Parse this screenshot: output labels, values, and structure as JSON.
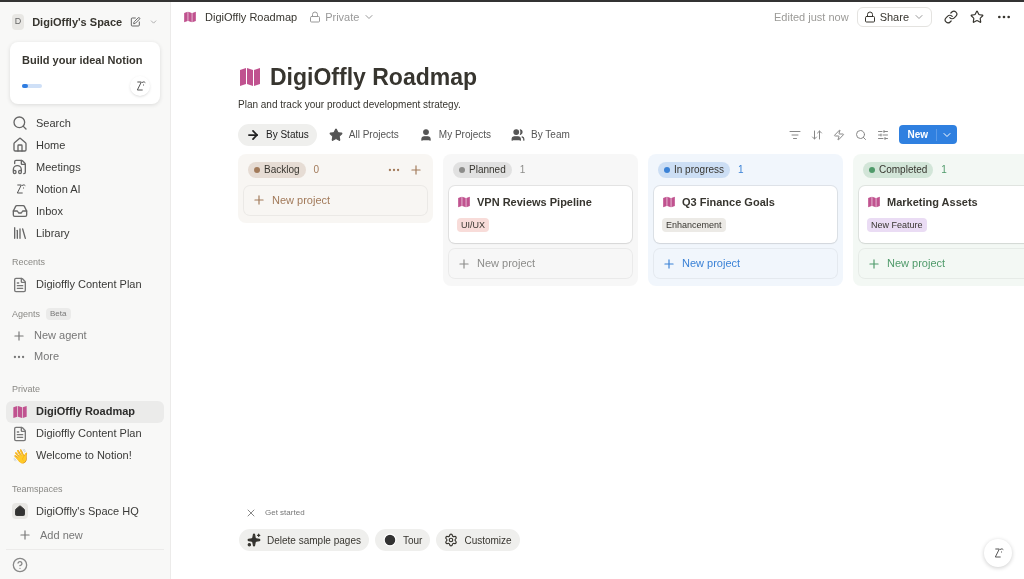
{
  "sidebar": {
    "workspace_initial": "D",
    "workspace": "DigiOffly's Space",
    "promo": {
      "title": "Build your ideal Notion",
      "level": 0.3
    },
    "nav": [
      "Search",
      "Home",
      "Meetings",
      "Notion AI",
      "Inbox",
      "Library"
    ],
    "recents_label": "Recents",
    "recents": [
      {
        "kind": "doc",
        "label": "Digioffly Content Plan",
        "selected": false
      }
    ],
    "agents_label": "Agents",
    "agents_badge": "Beta",
    "agents": [
      "New agent",
      "More"
    ],
    "private_label": "Private",
    "private": [
      {
        "kind": "board",
        "label": "DigiOffly Roadmap",
        "selected": true
      },
      {
        "kind": "doc",
        "label": "Digioffly Content Plan",
        "selected": false
      },
      {
        "kind": "emoji",
        "emoji": "👋",
        "label": "Welcome to Notion!",
        "selected": false
      }
    ],
    "teamspaces_label": "Teamspaces",
    "teamspaces": [
      {
        "kind": "home",
        "label": "DigiOffly's Space HQ",
        "selected": false
      }
    ],
    "add_new": "Add new"
  },
  "topbar": {
    "breadcrumb": "DigiOffly Roadmap",
    "privacy": "Private",
    "edited": "Edited just now",
    "share": "Share"
  },
  "page": {
    "title": "DigiOffly Roadmap",
    "description": "Plan and track your product development strategy."
  },
  "views": [
    {
      "label": "By Status",
      "selected": true
    },
    {
      "label": "All Projects",
      "selected": false
    },
    {
      "label": "My Projects",
      "selected": false
    },
    {
      "label": "By Team",
      "selected": false
    }
  ],
  "new_button": "New",
  "columns": [
    {
      "name": "Backlog",
      "count": "0",
      "color": "#a27a5a",
      "new_label": "New project"
    },
    {
      "name": "Planned",
      "count": "1",
      "color": "#8c8c8a",
      "cards": [
        {
          "title": "VPN Reviews Pipeline",
          "tag": {
            "label": "UI/UX",
            "color": "#f8dcd9"
          }
        }
      ],
      "new_label": "New project"
    },
    {
      "name": "In progress",
      "count": "1",
      "color": "#3b82d6",
      "cards": [
        {
          "title": "Q3 Finance Goals",
          "tag": {
            "label": "Enhancement",
            "color": "#eceae6"
          }
        }
      ],
      "new_label": "New project"
    },
    {
      "name": "Completed",
      "count": "1",
      "color": "#4f9a6a",
      "cards": [
        {
          "title": "Marketing Assets",
          "tag": {
            "label": "New Feature",
            "color": "#eadcf4"
          }
        }
      ],
      "new_label": "New project"
    }
  ],
  "get_started": {
    "label": "Get started",
    "buttons": [
      "Delete sample pages",
      "Tour",
      "Customize"
    ]
  }
}
